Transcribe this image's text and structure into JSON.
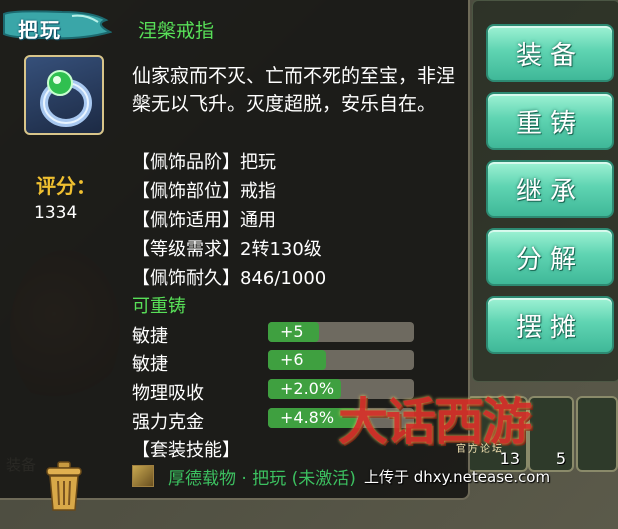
{
  "tooltip": {
    "rank_tag": "把玩",
    "item_name": "涅槃戒指",
    "score_label": "评分：",
    "score_value": "1334",
    "description": "仙家寂而不灭、亡而不死的至宝，非涅槃无以飞升。灭度超脱，安乐自在。",
    "attributes": [
      {
        "label": "【佩饰品阶】",
        "value": "把玩"
      },
      {
        "label": "【佩饰部位】",
        "value": "戒指"
      },
      {
        "label": "【佩饰适用】",
        "value": "通用"
      },
      {
        "label": "【等级需求】",
        "value": "2转130级"
      },
      {
        "label": "【佩饰耐久】",
        "value": "846/1000"
      }
    ],
    "reforge_label": "可重铸",
    "stats": [
      {
        "name": "敏捷",
        "value": "+5",
        "fill": 0.35
      },
      {
        "name": "敏捷",
        "value": "+6",
        "fill": 0.4
      },
      {
        "name": "物理吸收",
        "value": "+2.0%",
        "fill": 0.5
      },
      {
        "name": "强力克金",
        "value": "+4.8%",
        "fill": 0.6
      }
    ],
    "set_skill_label": "【套装技能】",
    "set_skill_name": "厚德载物 · 把玩 (未激活)"
  },
  "buttons": [
    {
      "id": "equip",
      "label": "装备"
    },
    {
      "id": "recast",
      "label": "重铸"
    },
    {
      "id": "inherit",
      "label": "继承"
    },
    {
      "id": "decompose",
      "label": "分解"
    },
    {
      "id": "stall",
      "label": "摆摊"
    }
  ],
  "inventory": {
    "slot_counts": [
      "13",
      "5"
    ]
  },
  "background_label": "装备",
  "watermark": {
    "logo": "大话西游",
    "sub": "官方论坛",
    "upload_text": "上传于 dhxy.netease.com"
  },
  "colors": {
    "name_green": "#58e058",
    "score_gold": "#f0c030",
    "button_teal": "#5fd4b2",
    "stat_fill": "#3fa040"
  }
}
